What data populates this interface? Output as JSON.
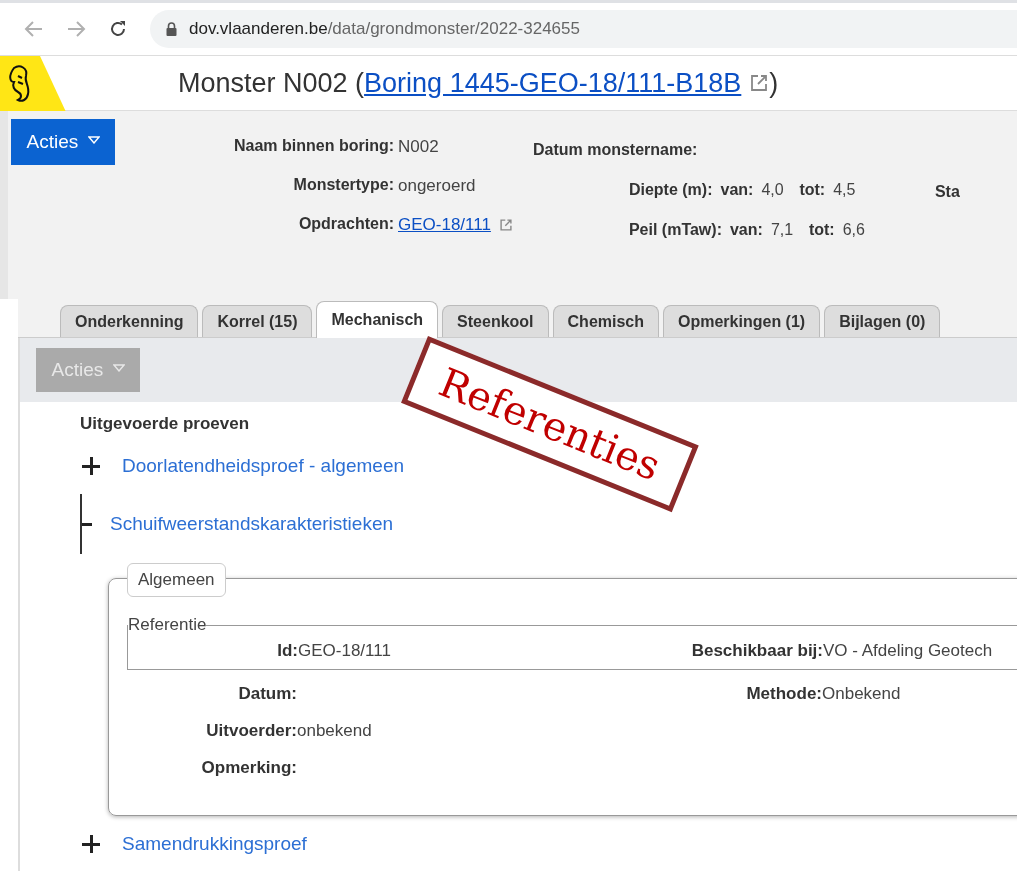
{
  "browser": {
    "url_host": "dov.vlaanderen.be",
    "url_path": "/data/grondmonster/2022-324655"
  },
  "header": {
    "title": "Monster N002 (",
    "link": "Boring 1445-GEO-18/111-B18B",
    "title_end": ")"
  },
  "actions_button": "Acties",
  "info": {
    "column_1": [
      {
        "kind": "text",
        "label": "Naam binnen boring:",
        "value": "N002"
      },
      {
        "kind": "text",
        "label": "Monstertype:",
        "value": "ongeroerd"
      },
      {
        "kind": "link",
        "label": "Opdrachten:",
        "value": "GEO-18/111"
      }
    ],
    "column_2": [
      {
        "kind": "text",
        "label": "Datum monstername:"
      },
      {
        "kind": "range",
        "label": "Diepte (m):",
        "from_label": "van:",
        "from": "4,0",
        "to_label": "tot:",
        "to": "4,5"
      },
      {
        "kind": "range",
        "label": "Peil (mTaw):",
        "from_label": "van:",
        "from": "7,1",
        "to_label": "tot:",
        "to": "6,6"
      }
    ],
    "column_3": "Sta"
  },
  "tabs": [
    {
      "label": "Onderkenning",
      "selected": false
    },
    {
      "label": "Korrel (15)",
      "selected": false
    },
    {
      "label": "Mechanisch",
      "selected": true
    },
    {
      "label": "Steenkool",
      "selected": false
    },
    {
      "label": "Chemisch",
      "selected": false
    },
    {
      "label": "Opmerkingen (1)",
      "selected": false
    },
    {
      "label": "Bijlagen (0)",
      "selected": false
    }
  ],
  "toolbar": {
    "button": "Acties",
    "disabled": true
  },
  "section_title": "Uitgevoerde proeven",
  "tests": [
    {
      "label": "Doorlatendheidsproef - algemeen",
      "expanded": false
    },
    {
      "label": "Schuifweerstandskarakteristieken",
      "expanded": true,
      "panel": {
        "tab": "Algemeen",
        "fieldset": "Referentie",
        "reference": [
          {
            "label": "Id:",
            "value": "GEO-18/111"
          },
          {
            "label": "Beschikbaar bij:",
            "value": "VO - Afdeling Geotech"
          }
        ],
        "rows": [
          [
            {
              "label": "Datum:"
            },
            {
              "label": "Methode:",
              "value": "Onbekend"
            }
          ],
          [
            {
              "label": "Uitvoerder:",
              "value": "onbekend"
            }
          ],
          [
            {
              "label": "Opmerking:"
            }
          ]
        ]
      }
    },
    {
      "label": "Samendrukkingsproef",
      "expanded": false
    }
  ],
  "stamp": "Referenties"
}
